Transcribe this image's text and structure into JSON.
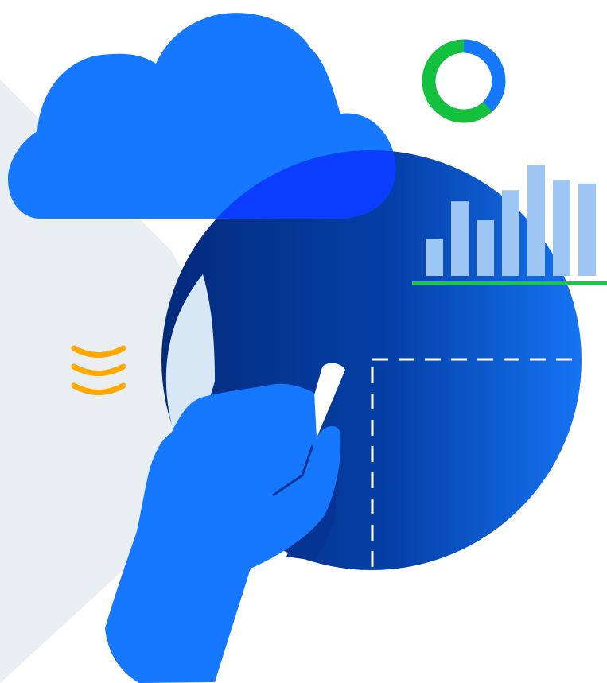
{
  "illustration": {
    "colors": {
      "background": "#ffffff",
      "backdrop": "#e8eef2",
      "cloud": "#1677ff",
      "cloud_overlap": "#0a3dff",
      "globe_dark": "#052f86",
      "globe_light": "#1572f0",
      "globe_pale": "#d7e7f5",
      "hand": "#1677ff",
      "hand_shadow": "#063494",
      "chalk": "#ffffff",
      "dashed_line": "#ffffff",
      "bars": "#9dc6f5",
      "baseline": "#1fc44a",
      "donut_green": "#13c13f",
      "donut_blue": "#1677ff",
      "signal_waves": "#ffa800"
    },
    "elements": {
      "cloud_icon": "cloud-icon",
      "globe": "globe-shape",
      "hand": "hand-holding-chalk-icon",
      "bar_chart": "bar-chart-icon",
      "donut": "donut-chart-icon",
      "waves": "signal-waves-icon"
    },
    "bar_chart": {
      "values": [
        0.33,
        0.67,
        0.5,
        0.77,
        1.0,
        0.86,
        0.83
      ]
    },
    "donut_chart": {
      "segments": [
        {
          "name": "blue",
          "fraction": 0.37
        },
        {
          "name": "green",
          "fraction": 0.63
        }
      ]
    }
  }
}
